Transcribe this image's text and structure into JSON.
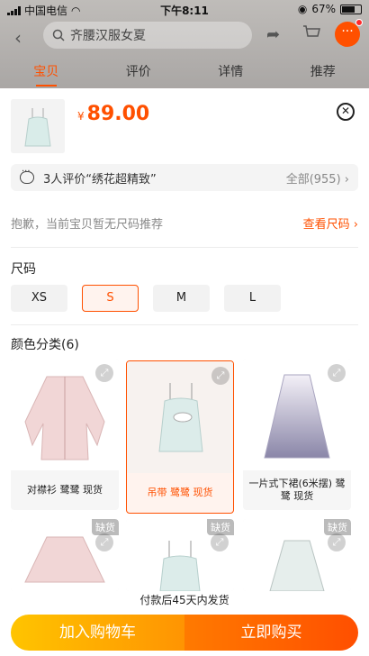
{
  "status_bar": {
    "carrier": "中国电信",
    "time": "下午8:11",
    "battery": "67%"
  },
  "header": {
    "search_text": "齐腰汉服女夏",
    "tabs": [
      {
        "label": "宝贝",
        "active": true
      },
      {
        "label": "评价",
        "active": false
      },
      {
        "label": "详情",
        "active": false
      },
      {
        "label": "推荐",
        "active": false
      }
    ]
  },
  "product": {
    "currency": "¥",
    "price": "89.00"
  },
  "review": {
    "text": "3人评价“绣花超精致”",
    "all": "全部(955)"
  },
  "size_tip": {
    "text": "抱歉，当前宝贝暂无尺码推荐",
    "link": "查看尺码 ›"
  },
  "size_section": {
    "label": "尺码",
    "options": [
      {
        "label": "XS",
        "selected": false
      },
      {
        "label": "S",
        "selected": true
      },
      {
        "label": "M",
        "selected": false
      },
      {
        "label": "L",
        "selected": false
      }
    ]
  },
  "color_section": {
    "label": "颜色分类(6)",
    "items": [
      {
        "caption": "对襟衫 鹭鹭 现货",
        "selected": false,
        "out_of_stock": false
      },
      {
        "caption": "吊带 鹭鹭 现货",
        "selected": true,
        "out_of_stock": false
      },
      {
        "caption": "一片式下裙(6米摆) 鹭鹭 现货",
        "selected": false,
        "out_of_stock": false
      },
      {
        "caption": "",
        "selected": false,
        "out_of_stock": true,
        "badge": "缺货"
      },
      {
        "caption": "",
        "selected": false,
        "out_of_stock": true,
        "badge": "缺货"
      },
      {
        "caption": "",
        "selected": false,
        "out_of_stock": true,
        "badge": "缺货"
      }
    ]
  },
  "shipping_note": "付款后45天内发货",
  "actions": {
    "cart": "加入购物车",
    "buy": "立即购买"
  },
  "colors": {
    "accent": "#ff5000",
    "cart": "#ffa200"
  }
}
